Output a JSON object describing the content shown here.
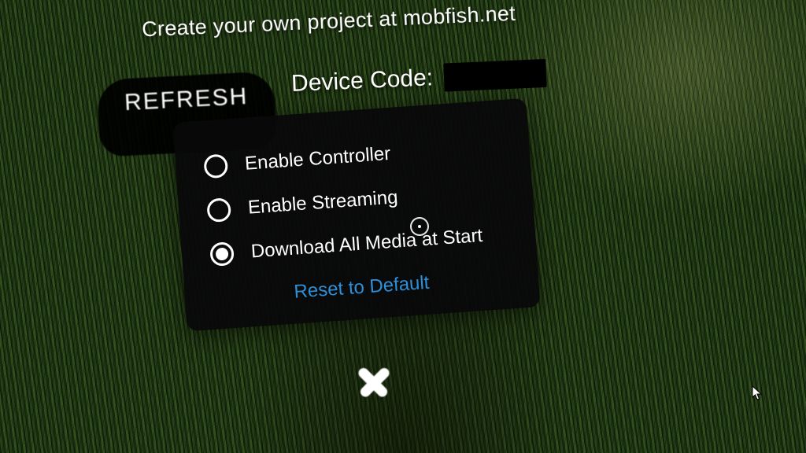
{
  "banner": {
    "text": "Create your own project at mobfish.net"
  },
  "device": {
    "label": "Device Code:",
    "value": ""
  },
  "refresh": {
    "label": "REFRESH"
  },
  "options": {
    "controller": {
      "label": "Enable Controller",
      "selected": false
    },
    "streaming": {
      "label": "Enable Streaming",
      "selected": false
    },
    "download": {
      "label": "Download All Media at Start",
      "selected": true
    }
  },
  "reset": {
    "label": "Reset to Default"
  },
  "colors": {
    "link": "#2e8fd8",
    "panel": "#08080a"
  }
}
